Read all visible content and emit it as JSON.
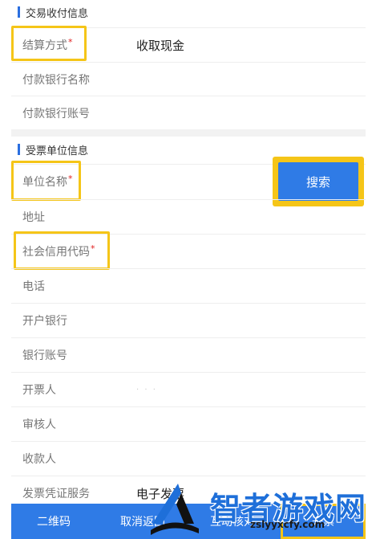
{
  "sections": {
    "payment_title": "交易收付信息",
    "recipient_title": "受票单位信息"
  },
  "payment": {
    "method_label": "结算方式",
    "method_value": "收取现金",
    "bank_name_label": "付款银行名称",
    "bank_account_label": "付款银行账号"
  },
  "recipient": {
    "name_label": "单位名称",
    "search_label": "搜索",
    "address_label": "地址",
    "credit_code_label": "社会信用代码",
    "phone_label": "电话",
    "bank_label": "开户银行",
    "account_label": "银行账号",
    "issuer_label": "开票人",
    "reviewer_label": "审核人",
    "payee_label": "收款人",
    "voucher_label": "发票凭证服务",
    "voucher_value": "电子发票"
  },
  "required_mark": "*",
  "bottom_bar": {
    "qr_label": "二维码",
    "cancel_label": "取消返回",
    "verify_label": "互动核对",
    "issue_label": "开票"
  },
  "watermark": {
    "site_name": "智者游戏网",
    "site_url": "zslyyxcfy.com"
  },
  "colors": {
    "accent": "#2f7be6",
    "highlight": "#f5c518",
    "required": "#e02020"
  }
}
